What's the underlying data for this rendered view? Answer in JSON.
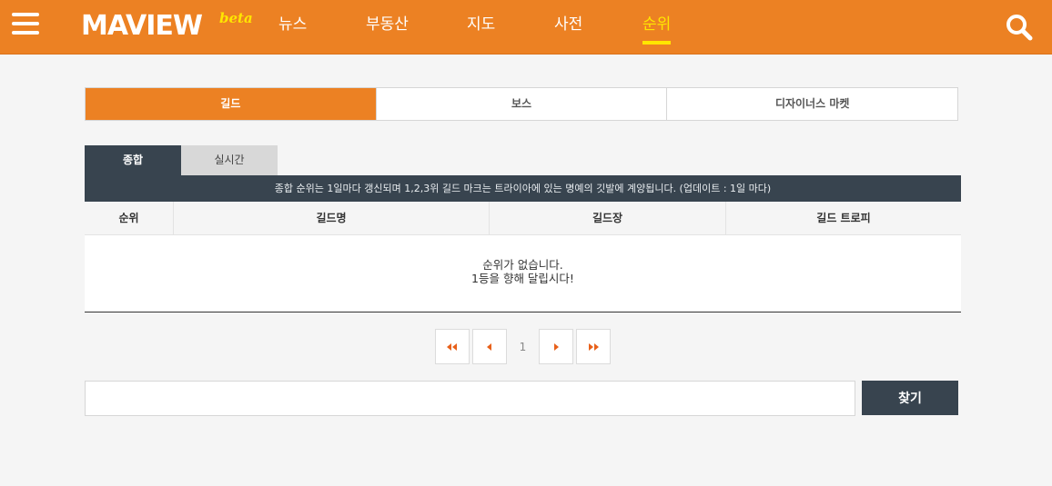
{
  "header": {
    "logo": "MAVIEW",
    "logo_badge": "beta",
    "nav": [
      {
        "label": "뉴스"
      },
      {
        "label": "부동산"
      },
      {
        "label": "지도"
      },
      {
        "label": "사전"
      },
      {
        "label": "순위",
        "active": true
      }
    ],
    "accent_color": "#ec8123",
    "active_color": "#ffe600"
  },
  "ranking_tabs": [
    {
      "label": "길드",
      "active": true
    },
    {
      "label": "보스"
    },
    {
      "label": "디자이너스 마켓"
    }
  ],
  "sub_tabs": [
    {
      "label": "종합",
      "active": true
    },
    {
      "label": "실시간"
    }
  ],
  "notice": "종합 순위는 1일마다 갱신되며 1,2,3위 길드 마크는 트라이아에 있는 명예의 깃발에 계양됩니다. (업데이트 : 1일 마다)",
  "table": {
    "columns": [
      "순위",
      "길드명",
      "길드장",
      "길드 트로피"
    ],
    "empty_line1": "순위가 없습니다.",
    "empty_line2": "1등을 향해 달립시다!"
  },
  "pagination": {
    "current_page": "1"
  },
  "search": {
    "value": "",
    "button_label": "찾기"
  }
}
